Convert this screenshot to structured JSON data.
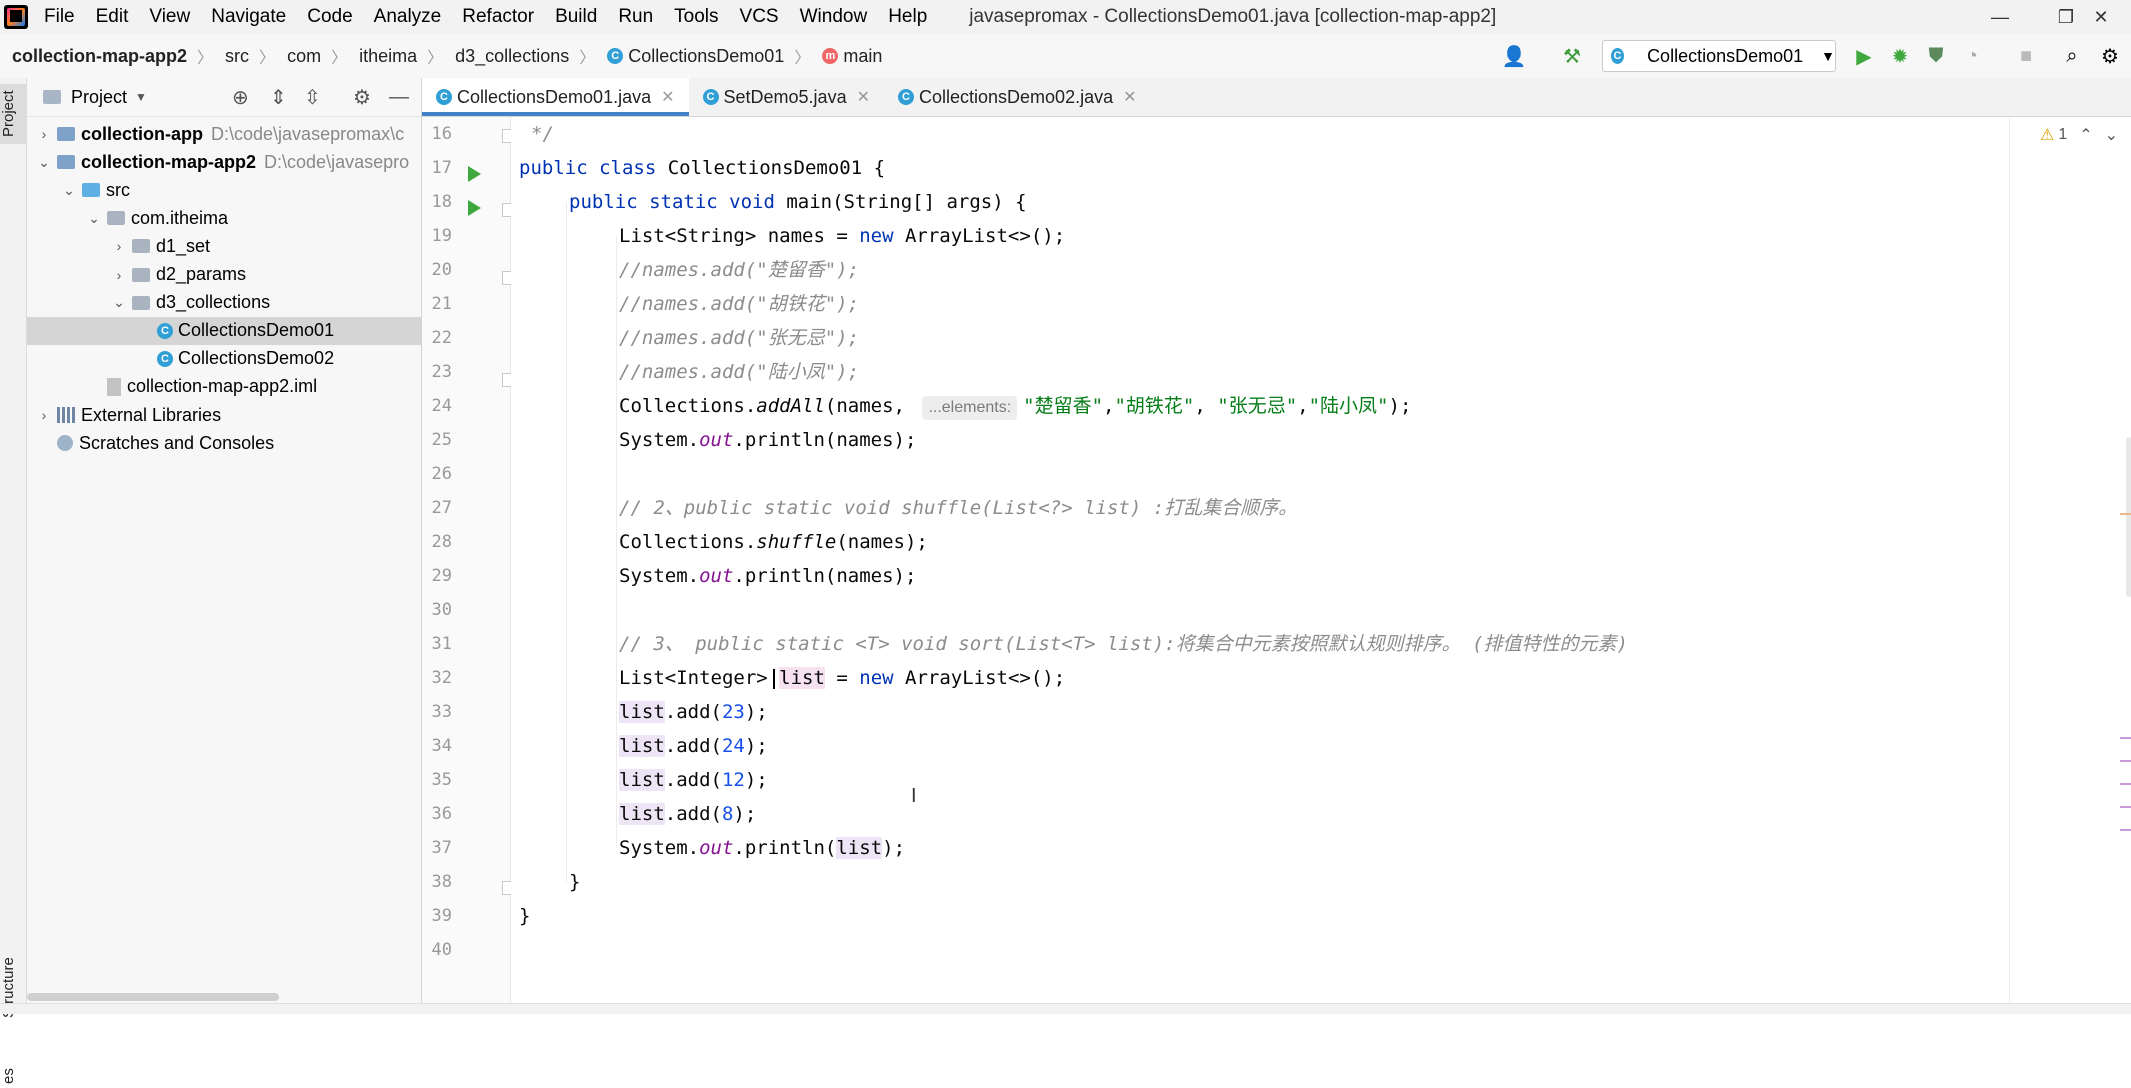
{
  "menu": {
    "items": [
      "File",
      "Edit",
      "View",
      "Navigate",
      "Code",
      "Analyze",
      "Refactor",
      "Build",
      "Run",
      "Tools",
      "VCS",
      "Window",
      "Help"
    ],
    "window_title": "javasepromax - CollectionsDemo01.java [collection-map-app2]"
  },
  "breadcrumbs": [
    "collection-map-app2",
    "src",
    "com",
    "itheima",
    "d3_collections",
    "CollectionsDemo01",
    "main"
  ],
  "run_config": "CollectionsDemo01",
  "project_panel": {
    "title": "Project",
    "tree": [
      {
        "label": "collection-app",
        "hint": "D:\\code\\javasepromax\\c",
        "bold": true,
        "depth": 0,
        "arrow": "›",
        "icon": "mod"
      },
      {
        "label": "collection-map-app2",
        "hint": "D:\\code\\javasepro",
        "bold": true,
        "depth": 0,
        "arrow": "⌄",
        "icon": "mod"
      },
      {
        "label": "src",
        "depth": 1,
        "arrow": "⌄",
        "icon": "src"
      },
      {
        "label": "com.itheima",
        "depth": 2,
        "arrow": "⌄",
        "icon": "pkg"
      },
      {
        "label": "d1_set",
        "depth": 3,
        "arrow": "›",
        "icon": "pkg"
      },
      {
        "label": "d2_params",
        "depth": 3,
        "arrow": "›",
        "icon": "pkg"
      },
      {
        "label": "d3_collections",
        "depth": 3,
        "arrow": "⌄",
        "icon": "pkg"
      },
      {
        "label": "CollectionsDemo01",
        "depth": 4,
        "arrow": "",
        "icon": "class",
        "selected": true
      },
      {
        "label": "CollectionsDemo02",
        "depth": 4,
        "arrow": "",
        "icon": "class"
      },
      {
        "label": "collection-map-app2.iml",
        "depth": 2,
        "arrow": "",
        "icon": "file"
      },
      {
        "label": "External Libraries",
        "depth": 0,
        "arrow": "›",
        "icon": "lib"
      },
      {
        "label": "Scratches and Consoles",
        "depth": 0,
        "arrow": "",
        "icon": "scratch"
      }
    ]
  },
  "side_tabs": {
    "project": "Project",
    "structure": "Structure",
    "bottom": "es"
  },
  "editor_tabs": [
    {
      "label": "CollectionsDemo01.java",
      "active": true
    },
    {
      "label": "SetDemo5.java",
      "active": false
    },
    {
      "label": "CollectionsDemo02.java",
      "active": false
    }
  ],
  "inspection": {
    "warnings": "1"
  },
  "code": {
    "line_numbers": [
      "16",
      "17",
      "18",
      "19",
      "20",
      "21",
      "22",
      "23",
      "24",
      "25",
      "26",
      "27",
      "28",
      "29",
      "30",
      "31",
      "32",
      "33",
      "34",
      "35",
      "36",
      "37",
      "38",
      "39",
      "40"
    ],
    "hint_label": "...elements:",
    "lines": {
      "l16": "*/",
      "l17a": "public class ",
      "l17b": "CollectionsDemo01 {",
      "l18a": "public static void ",
      "l18b": "main(String[] args) {",
      "l19a": "List<String> names = ",
      "l19b": "new ",
      "l19c": "ArrayList<>();",
      "l20": "//names.add(\"楚留香\");",
      "l21": "//names.add(\"胡铁花\");",
      "l22": "//names.add(\"张无忌\");",
      "l23": "//names.add(\"陆小凤\");",
      "l24a": "Collections.",
      "l24b": "addAll",
      "l24c": "(names, ",
      "l24s1": "\"楚留香\"",
      "l24s2": "\"胡铁花\"",
      "l24s3": "\"张无忌\"",
      "l24s4": "\"陆小凤\"",
      "l24sep1": ",",
      "l24sep2": ", ",
      "l24sep3": ",",
      "l24end": ");",
      "l25a": "System.",
      "l25b": "out",
      "l25c": ".println(names);",
      "l27": "// 2、public static void shuffle(List<?> list) :打乱集合顺序。",
      "l28a": "Collections.",
      "l28b": "shuffle",
      "l28c": "(names);",
      "l29a": "System.",
      "l29b": "out",
      "l29c": ".println(names);",
      "l31": "// 3、 public static <T> void sort(List<T> list):将集合中元素按照默认规则排序。 (排值特性的元素)",
      "l32a": "List<Integer> ",
      "l32b": "list",
      "l32c": " = ",
      "l32d": "new ",
      "l32e": "ArrayList<>();",
      "l33v": "list",
      "l33a": ".add(",
      "l33n": "23",
      "l33b": ");",
      "l34v": "list",
      "l34a": ".add(",
      "l34n": "24",
      "l34b": ");",
      "l35v": "list",
      "l35a": ".add(",
      "l35n": "12",
      "l35b": ");",
      "l36v": "list",
      "l36a": ".add(",
      "l36n": "8",
      "l36b": ");",
      "l37a": "System.",
      "l37b": "out",
      "l37c": ".println(",
      "l37v": "list",
      "l37d": ");",
      "l38": "}",
      "l39": "}"
    }
  }
}
